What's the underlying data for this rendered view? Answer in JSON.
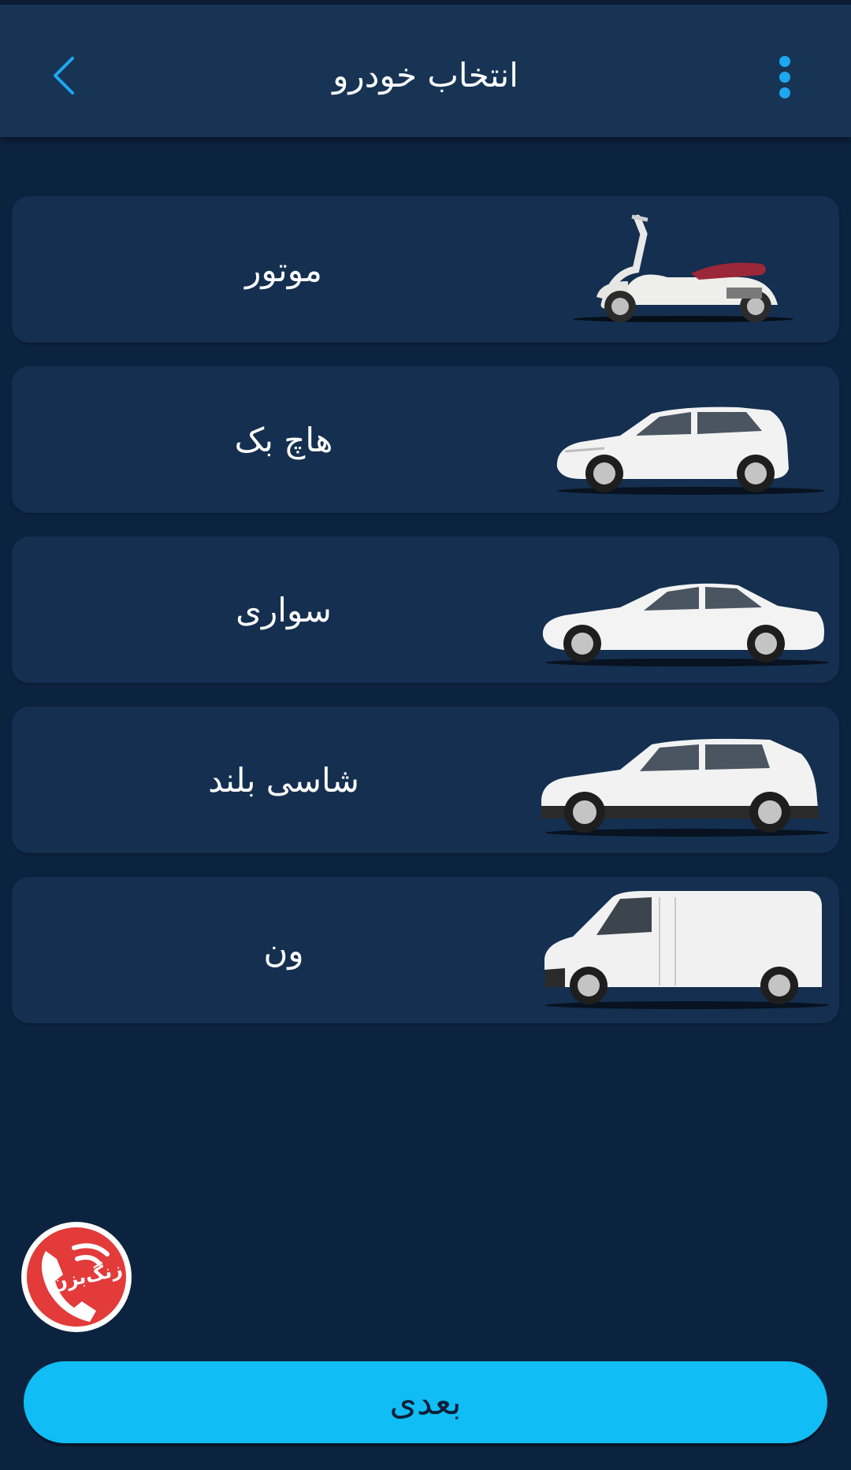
{
  "header": {
    "title": "انتخاب خودرو",
    "back_icon": "chevron-left-icon",
    "menu_icon": "more-vertical-icon"
  },
  "vehicles": [
    {
      "label": "موتور",
      "icon": "scooter"
    },
    {
      "label": "هاچ بک",
      "icon": "hatchback"
    },
    {
      "label": "سواری",
      "icon": "sedan"
    },
    {
      "label": "شاسی بلند",
      "icon": "suv"
    },
    {
      "label": "ون",
      "icon": "van"
    }
  ],
  "call_button": {
    "label": "زنگ‌بزن",
    "icon": "phone-icon"
  },
  "footer": {
    "next_label": "بعدی"
  },
  "colors": {
    "background": "#0c2340",
    "app_bar": "#173455",
    "card": "#142f50",
    "accent": "#10bdf4",
    "call_red": "#e33a3a"
  }
}
